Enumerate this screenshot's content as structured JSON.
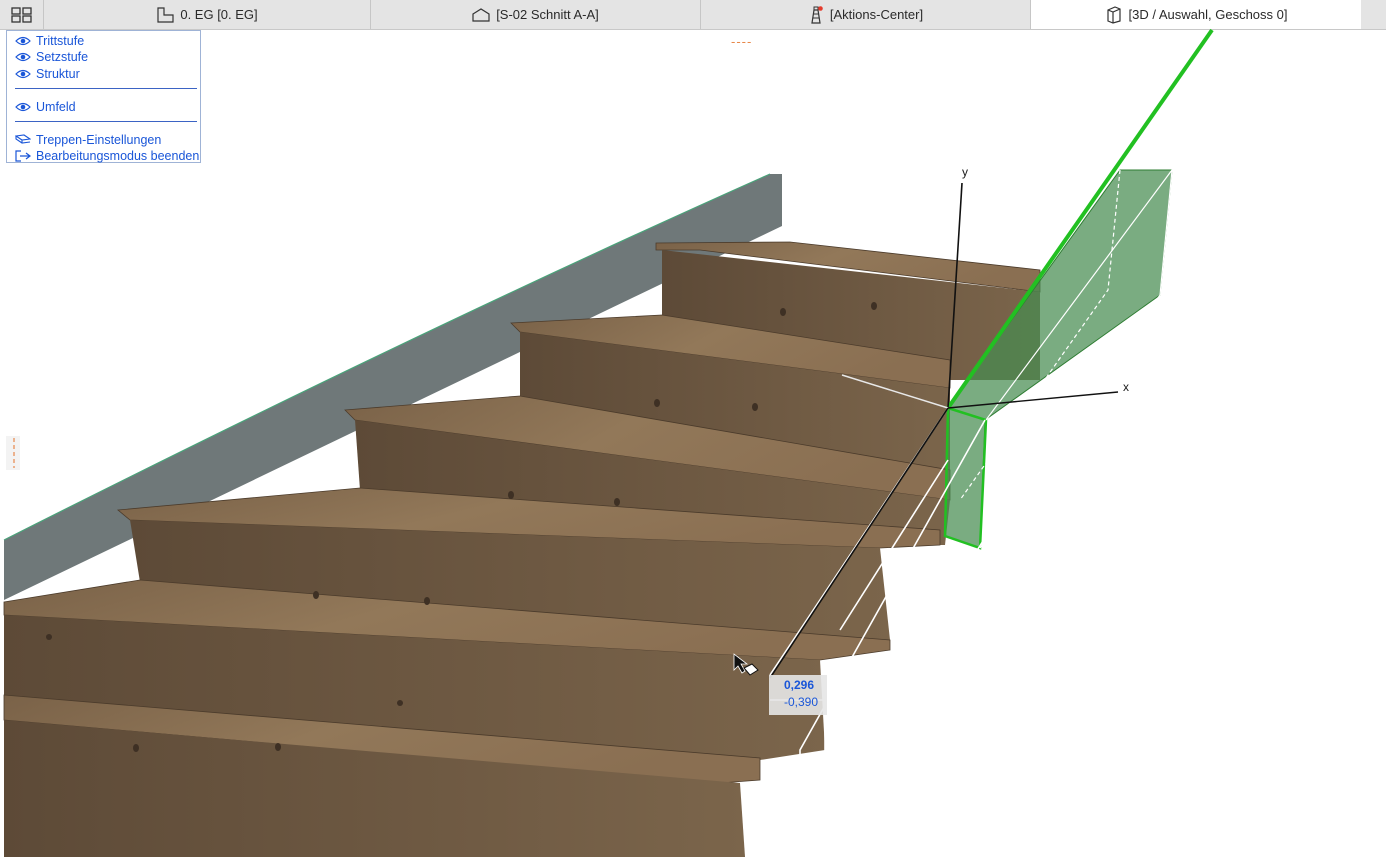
{
  "tabs": [
    {
      "label": "0. EG [0. EG]",
      "icon": "floor-plan-icon"
    },
    {
      "label": "[S-02 Schnitt A-A]",
      "icon": "section-icon"
    },
    {
      "label": "[Aktions-Center]",
      "icon": "lighthouse-icon"
    },
    {
      "label": "[3D / Auswahl, Geschoss 0]",
      "icon": "3d-view-icon"
    }
  ],
  "palette": {
    "trittstufe": "Trittstufe",
    "setzstufe": "Setzstufe",
    "struktur": "Struktur",
    "umfeld": "Umfeld",
    "einstellungen": "Treppen-Einstellungen",
    "beenden": "Bearbeitungsmodus beenden"
  },
  "dimension": {
    "value1": "0,296",
    "value2": "-0,390"
  },
  "axes": {
    "x": "x",
    "y": "y"
  },
  "markers": {
    "top": "----"
  },
  "colors": {
    "accent": "#1a56d8",
    "selection": "#22c022",
    "wood": "#8a7150",
    "stringer": "#6f7879"
  }
}
